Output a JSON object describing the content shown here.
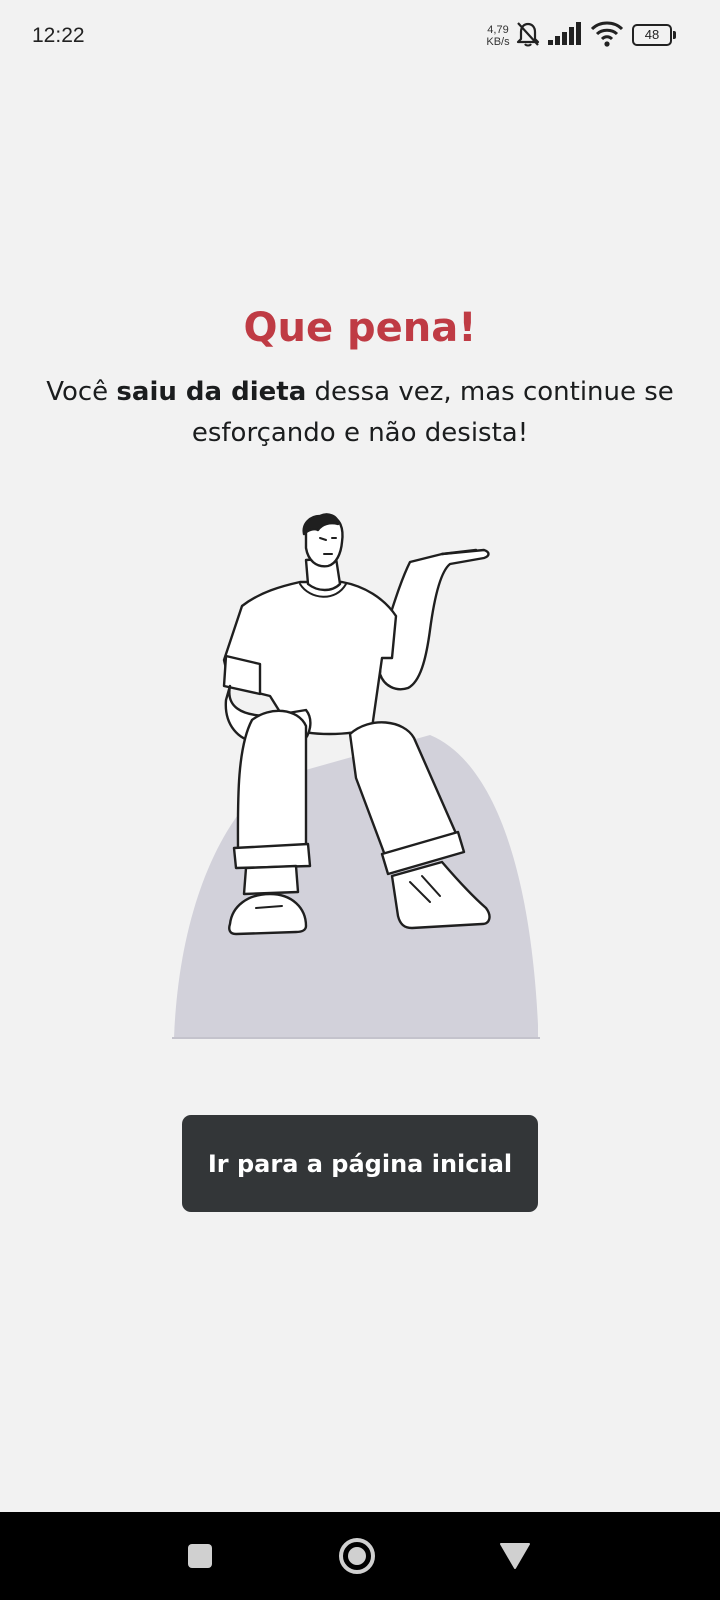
{
  "status_bar": {
    "time": "12:22",
    "net_speed_value": "4,79",
    "net_speed_unit": "KB/s",
    "battery_level": "48",
    "icons": [
      "bell-off-icon",
      "signal-icon",
      "wifi-icon",
      "battery-icon"
    ]
  },
  "content": {
    "title": "Que pena!",
    "message_prefix": "Você ",
    "message_bold": "saiu da dieta",
    "message_suffix": " dessa vez, mas continue se esforçando e não desista!",
    "illustration": "person-sitting-illustration",
    "button_label": "Ir para a página inicial"
  },
  "nav_bar": {
    "icons": [
      "recent-apps-icon",
      "home-icon",
      "back-icon"
    ]
  },
  "colors": {
    "background": "#f2f2f2",
    "title": "#bf3b44",
    "button_background": "#333638",
    "button_text": "#ffffff",
    "text": "#1b1d1e",
    "seat": "#d2d1da"
  }
}
